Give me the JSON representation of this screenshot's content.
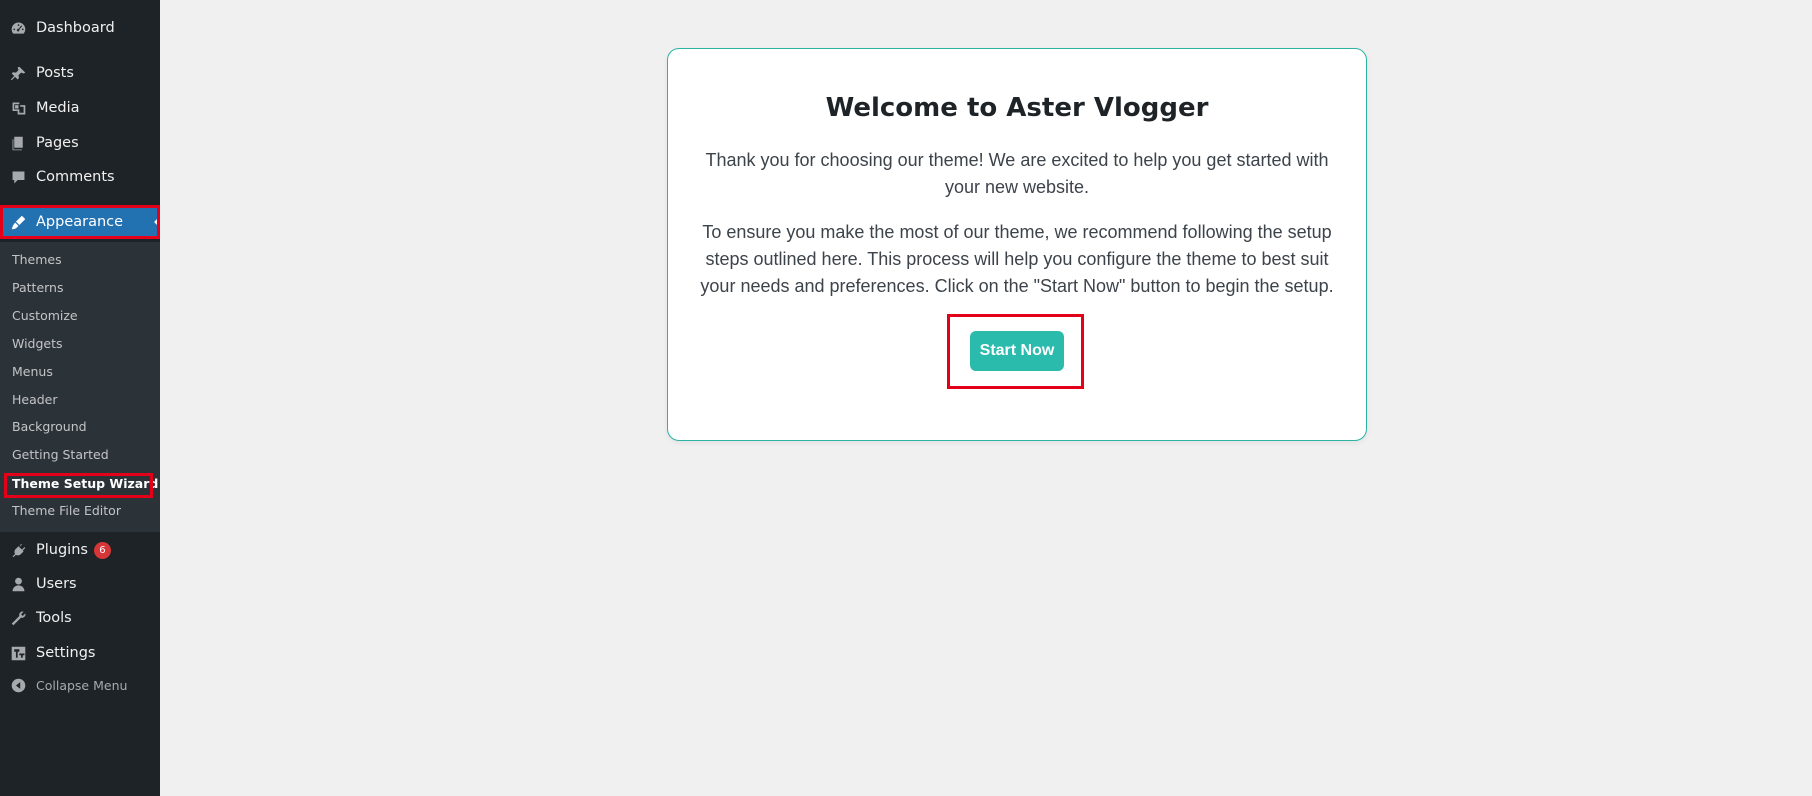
{
  "sidebar": {
    "items": {
      "dashboard": {
        "label": "Dashboard",
        "icon": "dashboard-icon"
      },
      "posts": {
        "label": "Posts",
        "icon": "pin-icon"
      },
      "media": {
        "label": "Media",
        "icon": "media-icon"
      },
      "pages": {
        "label": "Pages",
        "icon": "pages-icon"
      },
      "comments": {
        "label": "Comments",
        "icon": "comments-icon"
      },
      "appearance": {
        "label": "Appearance",
        "icon": "paintbrush-icon",
        "active": true
      },
      "plugins": {
        "label": "Plugins",
        "icon": "plugin-icon",
        "badge": "6"
      },
      "users": {
        "label": "Users",
        "icon": "user-icon"
      },
      "tools": {
        "label": "Tools",
        "icon": "wrench-icon"
      },
      "settings": {
        "label": "Settings",
        "icon": "settings-icon"
      },
      "collapse": {
        "label": "Collapse Menu",
        "icon": "collapse-icon"
      }
    },
    "submenu": {
      "themes": "Themes",
      "patterns": "Patterns",
      "customize": "Customize",
      "widgets": "Widgets",
      "menus": "Menus",
      "header": "Header",
      "background": "Background",
      "getting_started": "Getting Started",
      "theme_setup_wizard": "Theme Setup Wizard",
      "theme_file_editor": "Theme File Editor"
    }
  },
  "card": {
    "title": "Welcome to Aster Vlogger",
    "paragraph1": "Thank you for choosing our theme! We are excited to help you get started with your new website.",
    "paragraph2": "To ensure you make the most of our theme, we recommend following the setup steps outlined here. This process will help you configure the theme to best suit your needs and preferences. Click on the \"Start Now\" button to begin the setup.",
    "button_label": "Start Now"
  },
  "colors": {
    "sidebar_bg": "#1d2327",
    "submenu_bg": "#2c3338",
    "active_bg": "#2271b1",
    "accent": "#2bbbad",
    "highlight": "#e5001a",
    "badge": "#d63638"
  }
}
